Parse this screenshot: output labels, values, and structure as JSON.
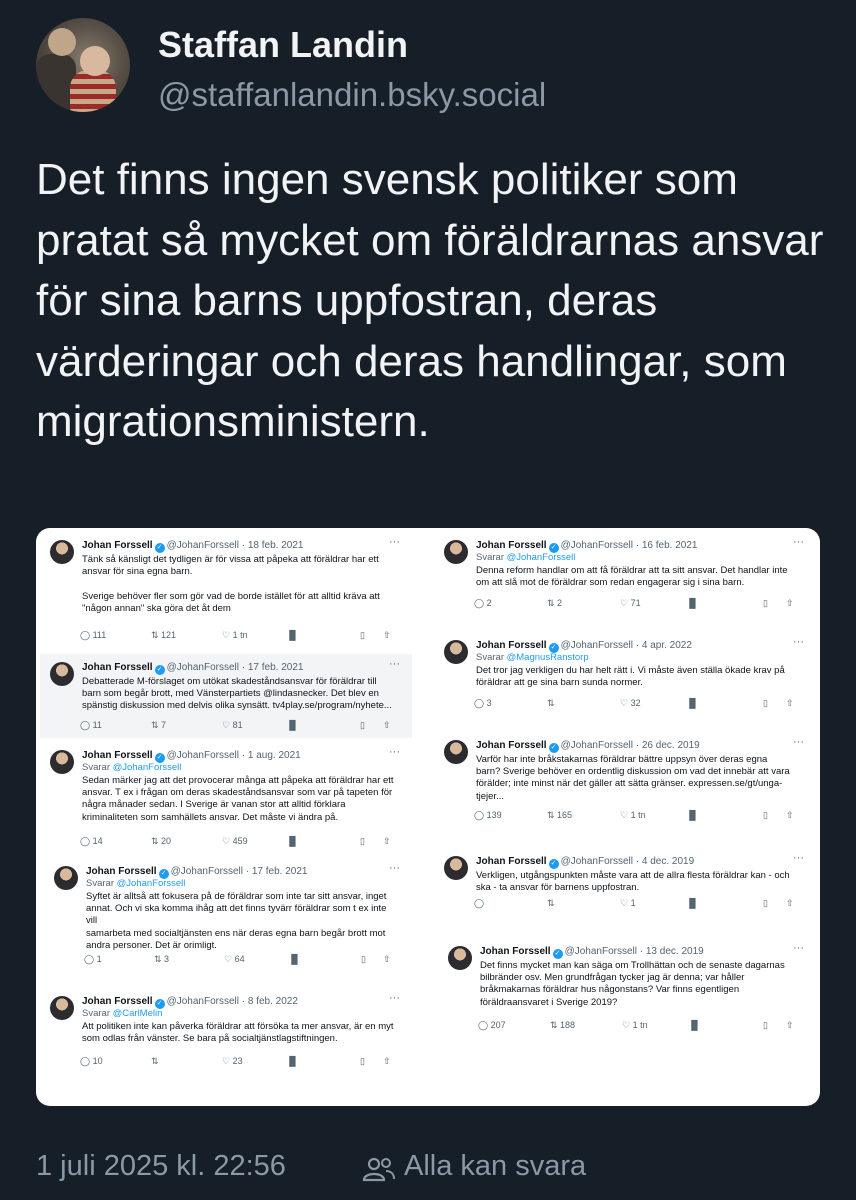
{
  "author": {
    "name": "Staffan Landin",
    "handle": "@staffanlandin.bsky.social"
  },
  "post": {
    "text": "Det finns ingen svensk politiker som pratat så mycket om föräldrarnas ansvar för sina barns uppfostran, deras värderingar och deras handlingar, som migrationsministern."
  },
  "embed_tweets": [
    {
      "author": "Johan Forssell",
      "handle": "@JohanForssell",
      "date": "18 feb. 2021",
      "reply_to": "",
      "text": "Tänk så känsligt det tydligen är för vissa att påpeka att föräldrar har ett\nansvar för sina egna barn.\n\nSverige behöver fler som gör vad de borde istället för att alltid kräva att\n\"någon annan\" ska göra det åt dem",
      "replies": "111",
      "reposts": "121",
      "likes": "1 tn"
    },
    {
      "author": "Johan Forssell",
      "handle": "@JohanForssell",
      "date": "17 feb. 2021",
      "reply_to": "",
      "text": "Debatterade M-förslaget om utökat skadeståndsansvar för föräldrar till\nbarn som begår brott, med Vänsterpartiets @lindasnecker. Det blev en\nspänstig diskussion med delvis olika synsätt. tv4play.se/program/nyhete...",
      "replies": "11",
      "reposts": "7",
      "likes": "81"
    },
    {
      "author": "Johan Forssell",
      "handle": "@JohanForssell",
      "date": "1 aug. 2021",
      "reply_to": "@JohanForssell",
      "text": "Sedan märker jag att det provocerar många att påpeka att föräldrar har ett\nansvar. T ex i frågan om deras skadeståndsansvar som var på tapeten för\nnågra månader sedan. I Sverige är vanan stor att alltid förklara\nkriminaliteten som samhällets ansvar. Det måste vi ändra på.",
      "replies": "14",
      "reposts": "20",
      "likes": "459"
    },
    {
      "author": "Johan Forssell",
      "handle": "@JohanForssell",
      "date": "17 feb. 2021",
      "reply_to": "@JohanForssell",
      "text": "Syftet är alltså att fokusera på de föräldrar som inte tar sitt ansvar, inget\nannat. Och vi ska komma ihåg att det finns tyvärr föräldrar som t ex inte vill\nsamarbeta med socialtjänsten ens när deras egna barn begår brott mot\nandra personer. Det är orimligt.",
      "replies": "1",
      "reposts": "3",
      "likes": "64"
    },
    {
      "author": "Johan Forssell",
      "handle": "@JohanForssell",
      "date": "8 feb. 2022",
      "reply_to": "@CarlMelin",
      "text": "Att politiken inte kan påverka föräldrar att försöka ta mer ansvar, är en myt\nsom odlas från vänster. Se bara på socialtjänstlagstiftningen.",
      "replies": "10",
      "reposts": "",
      "likes": "23"
    },
    {
      "author": "Johan Forssell",
      "handle": "@JohanForssell",
      "date": "16 feb. 2021",
      "reply_to": "@JohanForssell",
      "text": "Denna reform handlar om att få föräldrar att ta sitt ansvar. Det handlar inte\nom att slå mot de föräldrar som redan engagerar sig i sina barn.",
      "replies": "2",
      "reposts": "2",
      "likes": "71"
    },
    {
      "author": "Johan Forssell",
      "handle": "@JohanForssell",
      "date": "4 apr. 2022",
      "reply_to": "@MagnusRanstorp",
      "text": "Det tror jag verkligen du har helt rätt i. Vi måste även ställa ökade krav på\nföräldrar att ge sina barn sunda normer.",
      "replies": "3",
      "reposts": "",
      "likes": "32"
    },
    {
      "author": "Johan Forssell",
      "handle": "@JohanForssell",
      "date": "26 dec. 2019",
      "reply_to": "",
      "text": "Varför har inte bråkstakarnas föräldrar bättre uppsyn över deras egna\nbarn? Sverige behöver en ordentlig diskussion om vad det innebär att vara\nförälder; inte minst när det gäller att sätta gränser. expressen.se/gt/unga-\ntjejer...",
      "replies": "139",
      "reposts": "165",
      "likes": "1 tn"
    },
    {
      "author": "Johan Forssell",
      "handle": "@JohanForssell",
      "date": "4 dec. 2019",
      "reply_to": "",
      "text": "Verkligen, utgångspunkten måste vara att de allra flesta föräldrar kan - och\nska - ta ansvar för barnens uppfostran.",
      "replies": "",
      "reposts": "",
      "likes": "1"
    },
    {
      "author": "Johan Forssell",
      "handle": "@JohanForssell",
      "date": "13 dec. 2019",
      "reply_to": "",
      "text": "Det finns mycket man kan säga om Trollhättan och de senaste dagarnas\nbilbränder osv. Men grundfrågan tycker jag är denna; var håller\nbråkmakarnas föräldrar hus någonstans? Var finns egentligen\nföräldraansvaret i Sverige 2019?",
      "replies": "207",
      "reposts": "188",
      "likes": "1 tn"
    }
  ],
  "embed_labels": {
    "reply_prefix": "Svarar",
    "more": "···",
    "views_icon": "bar-chart-icon"
  },
  "footer": {
    "timestamp": "1 juli 2025 kl. 22:56",
    "reply_setting": "Alla kan svara"
  },
  "colors": {
    "background": "#161e27",
    "text": "#f1f3f5",
    "muted": "#8b98a5",
    "link": "#1d9bf0"
  }
}
